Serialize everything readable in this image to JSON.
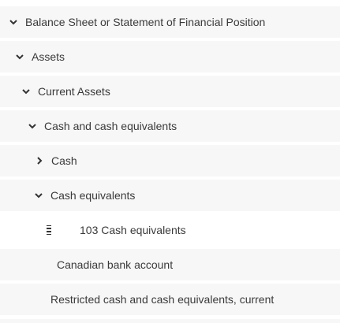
{
  "tree": {
    "rows": [
      {
        "label": "Balance Sheet or Statement of Financial Position",
        "state": "expanded"
      },
      {
        "label": "Assets",
        "state": "expanded"
      },
      {
        "label": "Current Assets",
        "state": "expanded"
      },
      {
        "label": "Cash and cash equivalents",
        "state": "expanded"
      },
      {
        "label": "Cash",
        "state": "collapsed"
      },
      {
        "label": "Cash equivalents",
        "state": "expanded"
      },
      {
        "label": "103 Cash equivalents",
        "state": "selected-draggable"
      },
      {
        "label": "Canadian bank account",
        "state": "leaf"
      },
      {
        "label": "Restricted cash and cash equivalents, current",
        "state": "leaf"
      }
    ]
  },
  "icons": {
    "expanded": "chevron-down-icon",
    "collapsed": "chevron-right-icon",
    "drag": "drag-handle-icon"
  },
  "colors": {
    "row_background": "#f7f7f7",
    "selected_background": "#ffffff",
    "text": "#3a3a3a"
  }
}
